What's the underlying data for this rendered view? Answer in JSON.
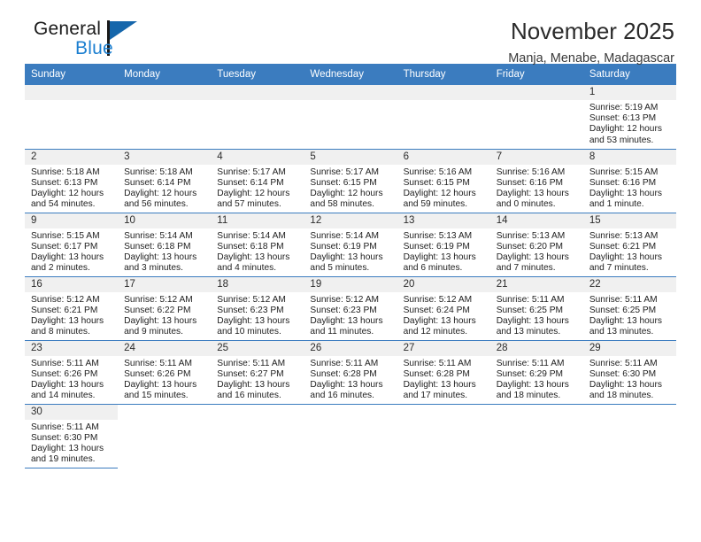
{
  "brand": {
    "name_top": "General",
    "name_bottom": "Blue",
    "accent_color": "#1566ab",
    "text_color": "#1a1a1a"
  },
  "header": {
    "title": "November 2025",
    "subtitle": "Manja, Menabe, Madagascar"
  },
  "calendar": {
    "header_bg": "#3b7cbf",
    "weekdays": [
      "Sunday",
      "Monday",
      "Tuesday",
      "Wednesday",
      "Thursday",
      "Friday",
      "Saturday"
    ],
    "weeks": [
      [
        {
          "day": "",
          "lines": []
        },
        {
          "day": "",
          "lines": []
        },
        {
          "day": "",
          "lines": []
        },
        {
          "day": "",
          "lines": []
        },
        {
          "day": "",
          "lines": []
        },
        {
          "day": "",
          "lines": []
        },
        {
          "day": "1",
          "lines": [
            "Sunrise: 5:19 AM",
            "Sunset: 6:13 PM",
            "Daylight: 12 hours",
            "and 53 minutes."
          ]
        }
      ],
      [
        {
          "day": "2",
          "lines": [
            "Sunrise: 5:18 AM",
            "Sunset: 6:13 PM",
            "Daylight: 12 hours",
            "and 54 minutes."
          ]
        },
        {
          "day": "3",
          "lines": [
            "Sunrise: 5:18 AM",
            "Sunset: 6:14 PM",
            "Daylight: 12 hours",
            "and 56 minutes."
          ]
        },
        {
          "day": "4",
          "lines": [
            "Sunrise: 5:17 AM",
            "Sunset: 6:14 PM",
            "Daylight: 12 hours",
            "and 57 minutes."
          ]
        },
        {
          "day": "5",
          "lines": [
            "Sunrise: 5:17 AM",
            "Sunset: 6:15 PM",
            "Daylight: 12 hours",
            "and 58 minutes."
          ]
        },
        {
          "day": "6",
          "lines": [
            "Sunrise: 5:16 AM",
            "Sunset: 6:15 PM",
            "Daylight: 12 hours",
            "and 59 minutes."
          ]
        },
        {
          "day": "7",
          "lines": [
            "Sunrise: 5:16 AM",
            "Sunset: 6:16 PM",
            "Daylight: 13 hours",
            "and 0 minutes."
          ]
        },
        {
          "day": "8",
          "lines": [
            "Sunrise: 5:15 AM",
            "Sunset: 6:16 PM",
            "Daylight: 13 hours",
            "and 1 minute."
          ]
        }
      ],
      [
        {
          "day": "9",
          "lines": [
            "Sunrise: 5:15 AM",
            "Sunset: 6:17 PM",
            "Daylight: 13 hours",
            "and 2 minutes."
          ]
        },
        {
          "day": "10",
          "lines": [
            "Sunrise: 5:14 AM",
            "Sunset: 6:18 PM",
            "Daylight: 13 hours",
            "and 3 minutes."
          ]
        },
        {
          "day": "11",
          "lines": [
            "Sunrise: 5:14 AM",
            "Sunset: 6:18 PM",
            "Daylight: 13 hours",
            "and 4 minutes."
          ]
        },
        {
          "day": "12",
          "lines": [
            "Sunrise: 5:14 AM",
            "Sunset: 6:19 PM",
            "Daylight: 13 hours",
            "and 5 minutes."
          ]
        },
        {
          "day": "13",
          "lines": [
            "Sunrise: 5:13 AM",
            "Sunset: 6:19 PM",
            "Daylight: 13 hours",
            "and 6 minutes."
          ]
        },
        {
          "day": "14",
          "lines": [
            "Sunrise: 5:13 AM",
            "Sunset: 6:20 PM",
            "Daylight: 13 hours",
            "and 7 minutes."
          ]
        },
        {
          "day": "15",
          "lines": [
            "Sunrise: 5:13 AM",
            "Sunset: 6:21 PM",
            "Daylight: 13 hours",
            "and 7 minutes."
          ]
        }
      ],
      [
        {
          "day": "16",
          "lines": [
            "Sunrise: 5:12 AM",
            "Sunset: 6:21 PM",
            "Daylight: 13 hours",
            "and 8 minutes."
          ]
        },
        {
          "day": "17",
          "lines": [
            "Sunrise: 5:12 AM",
            "Sunset: 6:22 PM",
            "Daylight: 13 hours",
            "and 9 minutes."
          ]
        },
        {
          "day": "18",
          "lines": [
            "Sunrise: 5:12 AM",
            "Sunset: 6:23 PM",
            "Daylight: 13 hours",
            "and 10 minutes."
          ]
        },
        {
          "day": "19",
          "lines": [
            "Sunrise: 5:12 AM",
            "Sunset: 6:23 PM",
            "Daylight: 13 hours",
            "and 11 minutes."
          ]
        },
        {
          "day": "20",
          "lines": [
            "Sunrise: 5:12 AM",
            "Sunset: 6:24 PM",
            "Daylight: 13 hours",
            "and 12 minutes."
          ]
        },
        {
          "day": "21",
          "lines": [
            "Sunrise: 5:11 AM",
            "Sunset: 6:25 PM",
            "Daylight: 13 hours",
            "and 13 minutes."
          ]
        },
        {
          "day": "22",
          "lines": [
            "Sunrise: 5:11 AM",
            "Sunset: 6:25 PM",
            "Daylight: 13 hours",
            "and 13 minutes."
          ]
        }
      ],
      [
        {
          "day": "23",
          "lines": [
            "Sunrise: 5:11 AM",
            "Sunset: 6:26 PM",
            "Daylight: 13 hours",
            "and 14 minutes."
          ]
        },
        {
          "day": "24",
          "lines": [
            "Sunrise: 5:11 AM",
            "Sunset: 6:26 PM",
            "Daylight: 13 hours",
            "and 15 minutes."
          ]
        },
        {
          "day": "25",
          "lines": [
            "Sunrise: 5:11 AM",
            "Sunset: 6:27 PM",
            "Daylight: 13 hours",
            "and 16 minutes."
          ]
        },
        {
          "day": "26",
          "lines": [
            "Sunrise: 5:11 AM",
            "Sunset: 6:28 PM",
            "Daylight: 13 hours",
            "and 16 minutes."
          ]
        },
        {
          "day": "27",
          "lines": [
            "Sunrise: 5:11 AM",
            "Sunset: 6:28 PM",
            "Daylight: 13 hours",
            "and 17 minutes."
          ]
        },
        {
          "day": "28",
          "lines": [
            "Sunrise: 5:11 AM",
            "Sunset: 6:29 PM",
            "Daylight: 13 hours",
            "and 18 minutes."
          ]
        },
        {
          "day": "29",
          "lines": [
            "Sunrise: 5:11 AM",
            "Sunset: 6:30 PM",
            "Daylight: 13 hours",
            "and 18 minutes."
          ]
        }
      ],
      [
        {
          "day": "30",
          "lines": [
            "Sunrise: 5:11 AM",
            "Sunset: 6:30 PM",
            "Daylight: 13 hours",
            "and 19 minutes."
          ]
        },
        {
          "day": "",
          "lines": []
        },
        {
          "day": "",
          "lines": []
        },
        {
          "day": "",
          "lines": []
        },
        {
          "day": "",
          "lines": []
        },
        {
          "day": "",
          "lines": []
        },
        {
          "day": "",
          "lines": []
        }
      ]
    ]
  }
}
